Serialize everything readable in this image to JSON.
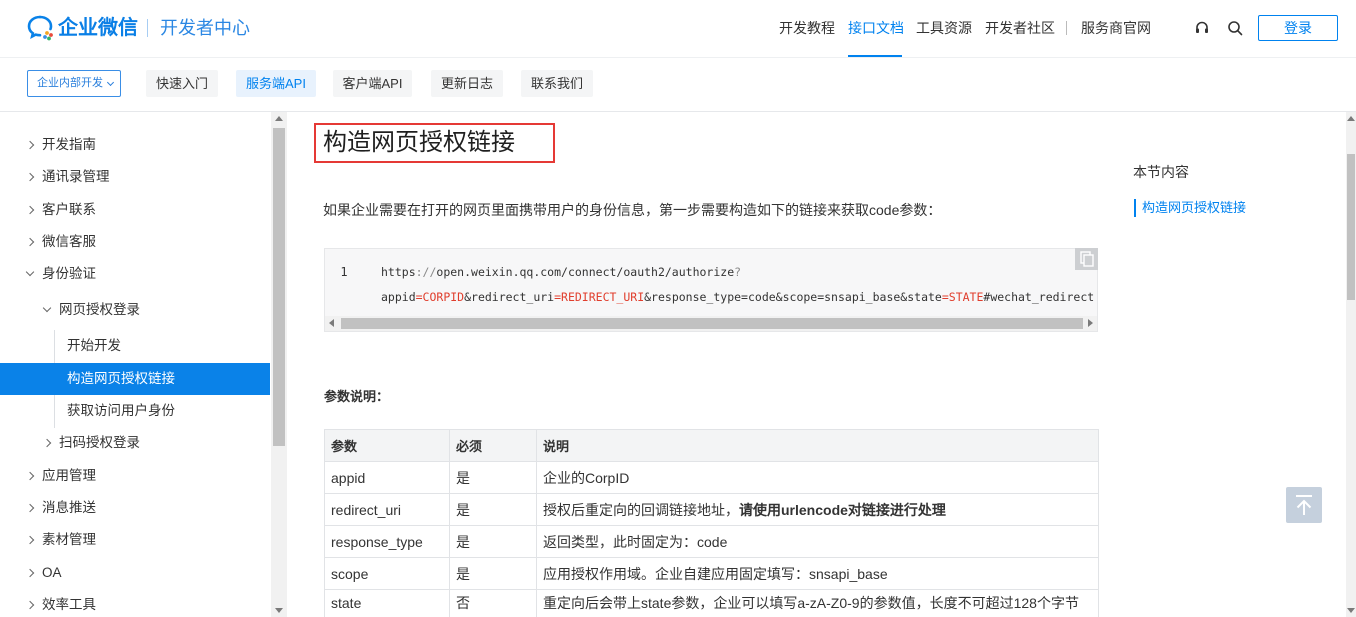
{
  "header": {
    "logo_text": "企业微信",
    "logo_subtitle": "开发者中心",
    "nav": [
      {
        "label": "开发教程",
        "active": false
      },
      {
        "label": "接口文档",
        "active": true
      },
      {
        "label": "工具资源",
        "active": false
      },
      {
        "label": "开发者社区",
        "active": false
      },
      {
        "label": "服务商官网",
        "active": false
      }
    ],
    "login_label": "登录"
  },
  "subnav": {
    "dropdown_label": "企业内部开发",
    "tabs": [
      {
        "label": "快速入门",
        "active": false
      },
      {
        "label": "服务端API",
        "active": true
      },
      {
        "label": "客户端API",
        "active": false
      },
      {
        "label": "更新日志",
        "active": false
      },
      {
        "label": "联系我们",
        "active": false
      }
    ]
  },
  "sidebar": {
    "items": [
      {
        "label": "开发指南",
        "expanded": false
      },
      {
        "label": "通讯录管理",
        "expanded": false
      },
      {
        "label": "客户联系",
        "expanded": false
      },
      {
        "label": "微信客服",
        "expanded": false
      },
      {
        "label": "身份验证",
        "expanded": true,
        "children": [
          {
            "label": "网页授权登录",
            "expanded": true,
            "children": [
              {
                "label": "开始开发",
                "active": false
              },
              {
                "label": "构造网页授权链接",
                "active": true
              },
              {
                "label": "获取访问用户身份",
                "active": false
              }
            ]
          },
          {
            "label": "扫码授权登录",
            "expanded": false
          }
        ]
      },
      {
        "label": "应用管理",
        "expanded": false
      },
      {
        "label": "消息推送",
        "expanded": false
      },
      {
        "label": "素材管理",
        "expanded": false
      },
      {
        "label": "OA",
        "expanded": false
      },
      {
        "label": "效率工具",
        "expanded": false
      }
    ]
  },
  "content": {
    "title": "构造网页授权链接",
    "intro": "如果企业需要在打开的网页里面携带用户的身份信息，第一步需要构造如下的链接来获取code参数：",
    "code": {
      "line_number": "1",
      "lines": [
        [
          {
            "text": "https",
            "color": "#333333"
          },
          {
            "text": "://",
            "color": "#8a8a8a"
          },
          {
            "text": "open.weixin.qq.com/connect/oauth2/authorize",
            "color": "#333333"
          },
          {
            "text": "?",
            "color": "#8a8a8a"
          }
        ],
        [
          {
            "text": "appid",
            "color": "#333333"
          },
          {
            "text": "=CORPID",
            "color": "#e03e2d"
          },
          {
            "text": "&redirect_uri",
            "color": "#333333"
          },
          {
            "text": "=REDIRECT_URI",
            "color": "#e03e2d"
          },
          {
            "text": "&response_type=code&scope=snsapi_base&state",
            "color": "#333333"
          },
          {
            "text": "=STATE",
            "color": "#e03e2d"
          },
          {
            "text": "#wechat_redirect",
            "color": "#333333"
          }
        ]
      ]
    },
    "params_heading": "参数说明：",
    "table": {
      "headers": [
        "参数",
        "必须",
        "说明"
      ],
      "rows": [
        {
          "param": "appid",
          "required": "是",
          "desc": "企业的CorpID"
        },
        {
          "param": "redirect_uri",
          "required": "是",
          "desc": "授权后重定向的回调链接地址，",
          "desc_bold": "请使用urlencode对链接进行处理"
        },
        {
          "param": "response_type",
          "required": "是",
          "desc": "返回类型，此时固定为：code"
        },
        {
          "param": "scope",
          "required": "是",
          "desc": "应用授权作用域。企业自建应用固定填写：snsapi_base"
        },
        {
          "param": "state",
          "required": "否",
          "desc": "重定向后会带上state参数，企业可以填写a-zA-Z0-9的参数值，长度不可超过128个字节"
        }
      ]
    }
  },
  "toc": {
    "heading": "本节内容",
    "items": [
      {
        "label": "构造网页授权链接",
        "active": true
      }
    ]
  },
  "icons": {
    "logo": "wecom-logo-icon",
    "support": "headset-icon",
    "search": "search-icon",
    "dropdown": "chevron-down-icon",
    "copy": "copy-icon",
    "back_to_top": "arrow-up-icon"
  },
  "colors": {
    "accent": "#0082ef",
    "highlight_box": "#e53935",
    "code_value": "#e03e2d",
    "table_header_bg": "#f3f4f5"
  }
}
